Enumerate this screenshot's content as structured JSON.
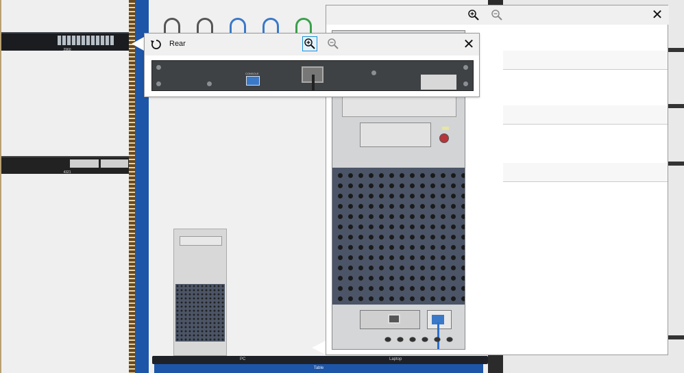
{
  "rack_left": {
    "switch_label": "2960",
    "router_label": "4321"
  },
  "workspace": {
    "table_labels": {
      "pc": "PC",
      "laptop": "Laptop",
      "table": "Table"
    }
  },
  "rear_popup": {
    "title": "Rear",
    "rotate_icon": "rotate-icon",
    "zoom_in_icon": "zoom-in-icon",
    "zoom_out_icon": "zoom-out-icon",
    "close_label": "✕",
    "panel_console_label": "CONSOLE"
  },
  "pc_popup": {
    "zoom_in_icon": "zoom-in-icon",
    "zoom_out_icon": "zoom-out-icon",
    "close_label": "✕"
  },
  "colors": {
    "rack_rail": "#6b4a1e",
    "blue_bar": "#1d56a8",
    "cable_blue": "#2b6fc9",
    "accent_active": "#1a8fd6"
  }
}
